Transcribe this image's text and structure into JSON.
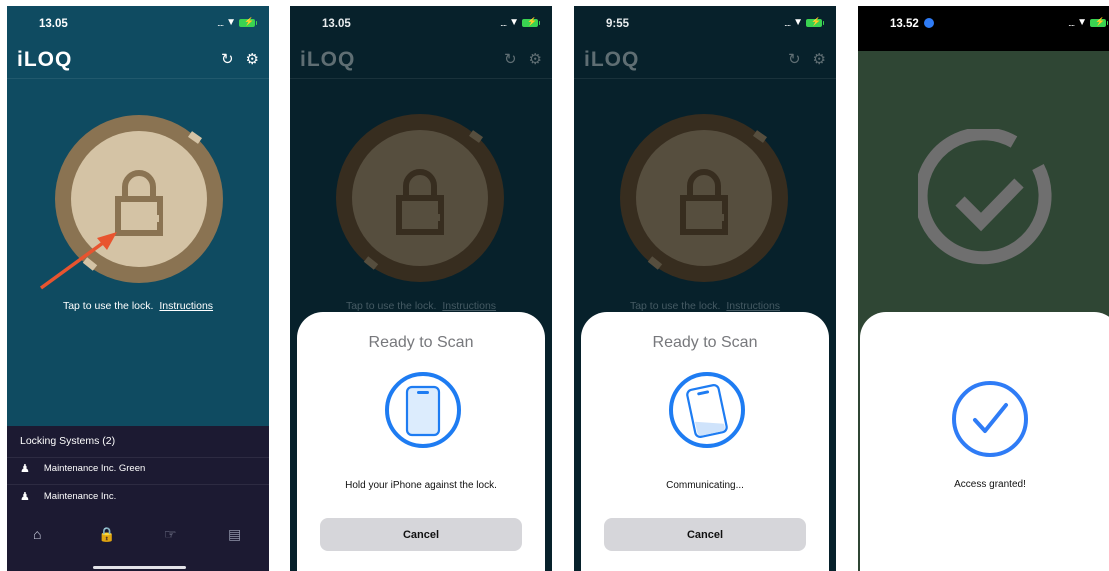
{
  "screens": [
    {
      "status": {
        "time": "13.05"
      },
      "app": {
        "logo": "iLOQ",
        "refresh_icon": "refresh-icon",
        "settings_icon": "gear-icon"
      },
      "tap_text": "Tap to use the lock.",
      "instructions_link": "Instructions",
      "locking_systems": {
        "title": "Locking Systems (2)",
        "items": [
          {
            "label": "Maintenance Inc. Green",
            "icon": "lock-holder-icon"
          },
          {
            "label": "Maintenance Inc.",
            "icon": "lock-holder-icon"
          }
        ]
      },
      "tabs": [
        "home-icon",
        "lock-icon",
        "key-hand-icon",
        "messages-icon"
      ],
      "colors": {
        "accent": "#1c1a32",
        "bg": "#0f4b61",
        "lock_ring": "#8a7352",
        "lock_face": "#d4c3a5",
        "arrow": "#e8542f"
      }
    },
    {
      "status": {
        "time": "13.05"
      },
      "app": {
        "logo": "iLOQ"
      },
      "tap_text": "Tap to use the lock.",
      "instructions_link": "Instructions",
      "sheet": {
        "title": "Ready to Scan",
        "message": "Hold your iPhone against the lock.",
        "cancel": "Cancel"
      }
    },
    {
      "status": {
        "time": "9:55"
      },
      "app": {
        "logo": "iLOQ"
      },
      "tap_text": "Tap to use the lock.",
      "instructions_link": "Instructions",
      "sheet": {
        "title": "Ready to Scan",
        "message": "Communicating...",
        "cancel": "Cancel"
      }
    },
    {
      "status": {
        "time": "13.52"
      },
      "sheet": {
        "message": "Access granted!"
      },
      "colors": {
        "success": "#2f7cf6",
        "bg": "#2f4634"
      }
    }
  ]
}
